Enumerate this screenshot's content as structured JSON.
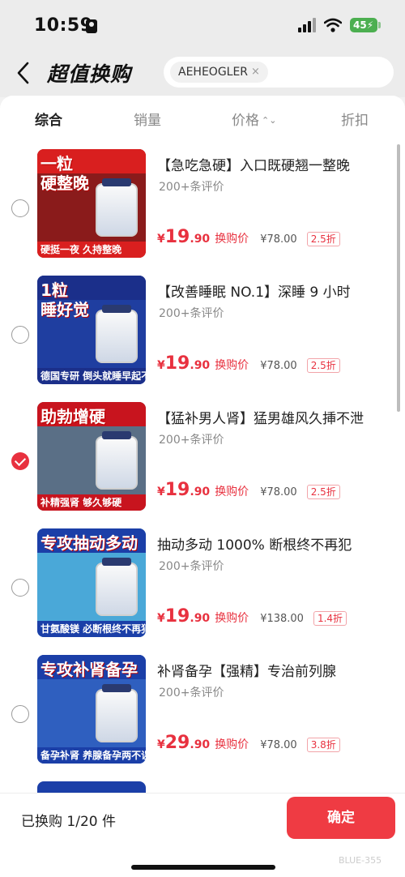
{
  "status_bar": {
    "time": "10:59",
    "battery": "45"
  },
  "header": {
    "title": "超值换购",
    "search_chip": "AEHEOGLER",
    "chip_close": "×"
  },
  "tabs": [
    {
      "label": "综合",
      "active": true
    },
    {
      "label": "销量",
      "active": false
    },
    {
      "label": "价格",
      "active": false
    },
    {
      "label": "折扣",
      "active": false
    }
  ],
  "products": [
    {
      "title": "【急吃急硬】入口既硬翘一整晚",
      "reviews": "200+条评价",
      "price_symbol": "¥",
      "price_int": "19",
      "price_dec": ".90",
      "swap_label": "换购价",
      "original_price": "¥78.00",
      "discount": "2.5折",
      "selected": false,
      "thumb": {
        "headline": "一粒\n硬整晚",
        "strip": "硬挺一夜 久持整晚",
        "top_color": "#d91f1f",
        "bg": "#8a1b1b"
      }
    },
    {
      "title": "【改善睡眠 NO.1】深睡 9 小时",
      "reviews": "200+条评价",
      "price_symbol": "¥",
      "price_int": "19",
      "price_dec": ".90",
      "swap_label": "换购价",
      "original_price": "¥78.00",
      "discount": "2.5折",
      "selected": false,
      "thumb": {
        "headline": "1粒\n睡好觉",
        "strip": "德国专研 倒头就睡早起不累",
        "top_color": "#1b2f8a",
        "bg": "#1f3ea0"
      }
    },
    {
      "title": "【猛补男人肾】猛男雄风久挿不泄",
      "reviews": "200+条评价",
      "price_symbol": "¥",
      "price_int": "19",
      "price_dec": ".90",
      "swap_label": "换购价",
      "original_price": "¥78.00",
      "discount": "2.5折",
      "selected": true,
      "thumb": {
        "headline": "助勃增硬",
        "strip": "补精强肾 够久够硬",
        "top_color": "#c8141e",
        "bg": "#5a6f86"
      }
    },
    {
      "title": "抽动多动 1000% 断根终不再犯",
      "reviews": "200+条评价",
      "price_symbol": "¥",
      "price_int": "19",
      "price_dec": ".90",
      "swap_label": "换购价",
      "original_price": "¥138.00",
      "discount": "1.4折",
      "selected": false,
      "thumb": {
        "headline": "专攻抽动多动",
        "strip": "甘氨酸镁 必断根终不再犯",
        "top_color": "#1b3fa8",
        "bg": "#4aa8d8"
      }
    },
    {
      "title": "补肾备孕【强精】专治前列腺",
      "reviews": "200+条评价",
      "price_symbol": "¥",
      "price_int": "29",
      "price_dec": ".90",
      "swap_label": "换购价",
      "original_price": "¥78.00",
      "discount": "3.8折",
      "selected": false,
      "thumb": {
        "headline": "专攻补肾备孕",
        "strip": "备孕补肾 养腺备孕两不误",
        "top_color": "#1b3fa8",
        "bg": "#2f5fbf"
      }
    }
  ],
  "bottom": {
    "count_label": "已换购 1/20 件",
    "confirm_label": "确定",
    "watermark": "BLUE-355"
  },
  "colors": {
    "accent": "#e8313f",
    "confirm_bg": "#ef3b43"
  }
}
